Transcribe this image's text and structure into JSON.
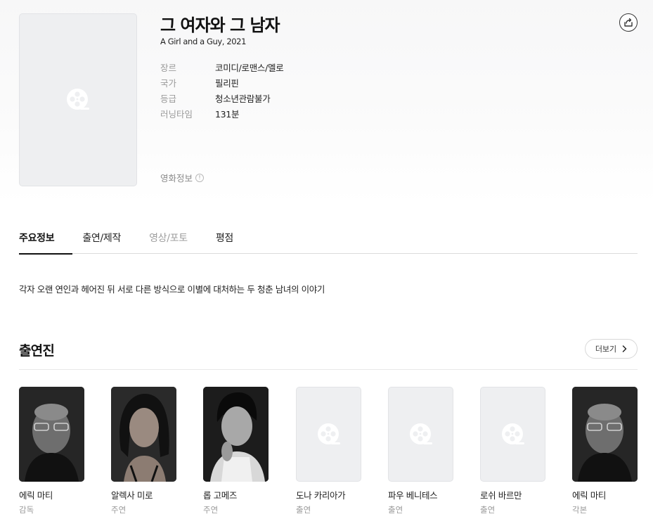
{
  "movie": {
    "title": "그 여자와 그 남자",
    "subtitle": "A Girl and a Guy, 2021",
    "meta": [
      {
        "label": "장르",
        "value": "코미디/로맨스/멜로"
      },
      {
        "label": "국가",
        "value": "필리핀"
      },
      {
        "label": "등급",
        "value": "청소년관람불가"
      },
      {
        "label": "러닝타임",
        "value": "131분"
      }
    ],
    "info_label": "영화정보",
    "info_badge": "!"
  },
  "tabs": [
    {
      "label": "주요정보"
    },
    {
      "label": "출연/제작"
    },
    {
      "label": "영상/포토"
    },
    {
      "label": "평점"
    }
  ],
  "synopsis": "각자 오랜 연인과 헤어진 뒤 서로 다른 방식으로 이별에 대처하는 두 청춘 남녀의 이야기",
  "cast_section": {
    "title": "출연진",
    "more_label": "더보기",
    "members": [
      {
        "name": "에릭 마티",
        "role": "감독"
      },
      {
        "name": "알렉사 미로",
        "role": "주연"
      },
      {
        "name": "롭 고메즈",
        "role": "주연"
      },
      {
        "name": "도나 카리아가",
        "role": "출연"
      },
      {
        "name": "파우 베니테스",
        "role": "출연"
      },
      {
        "name": "로쉬 바르만",
        "role": "출연"
      },
      {
        "name": "에릭 마티",
        "role": "각본"
      }
    ]
  },
  "icons": {
    "poster_placeholder": "film-reel-icon",
    "share": "share-icon",
    "more": "chevron-right-icon"
  }
}
